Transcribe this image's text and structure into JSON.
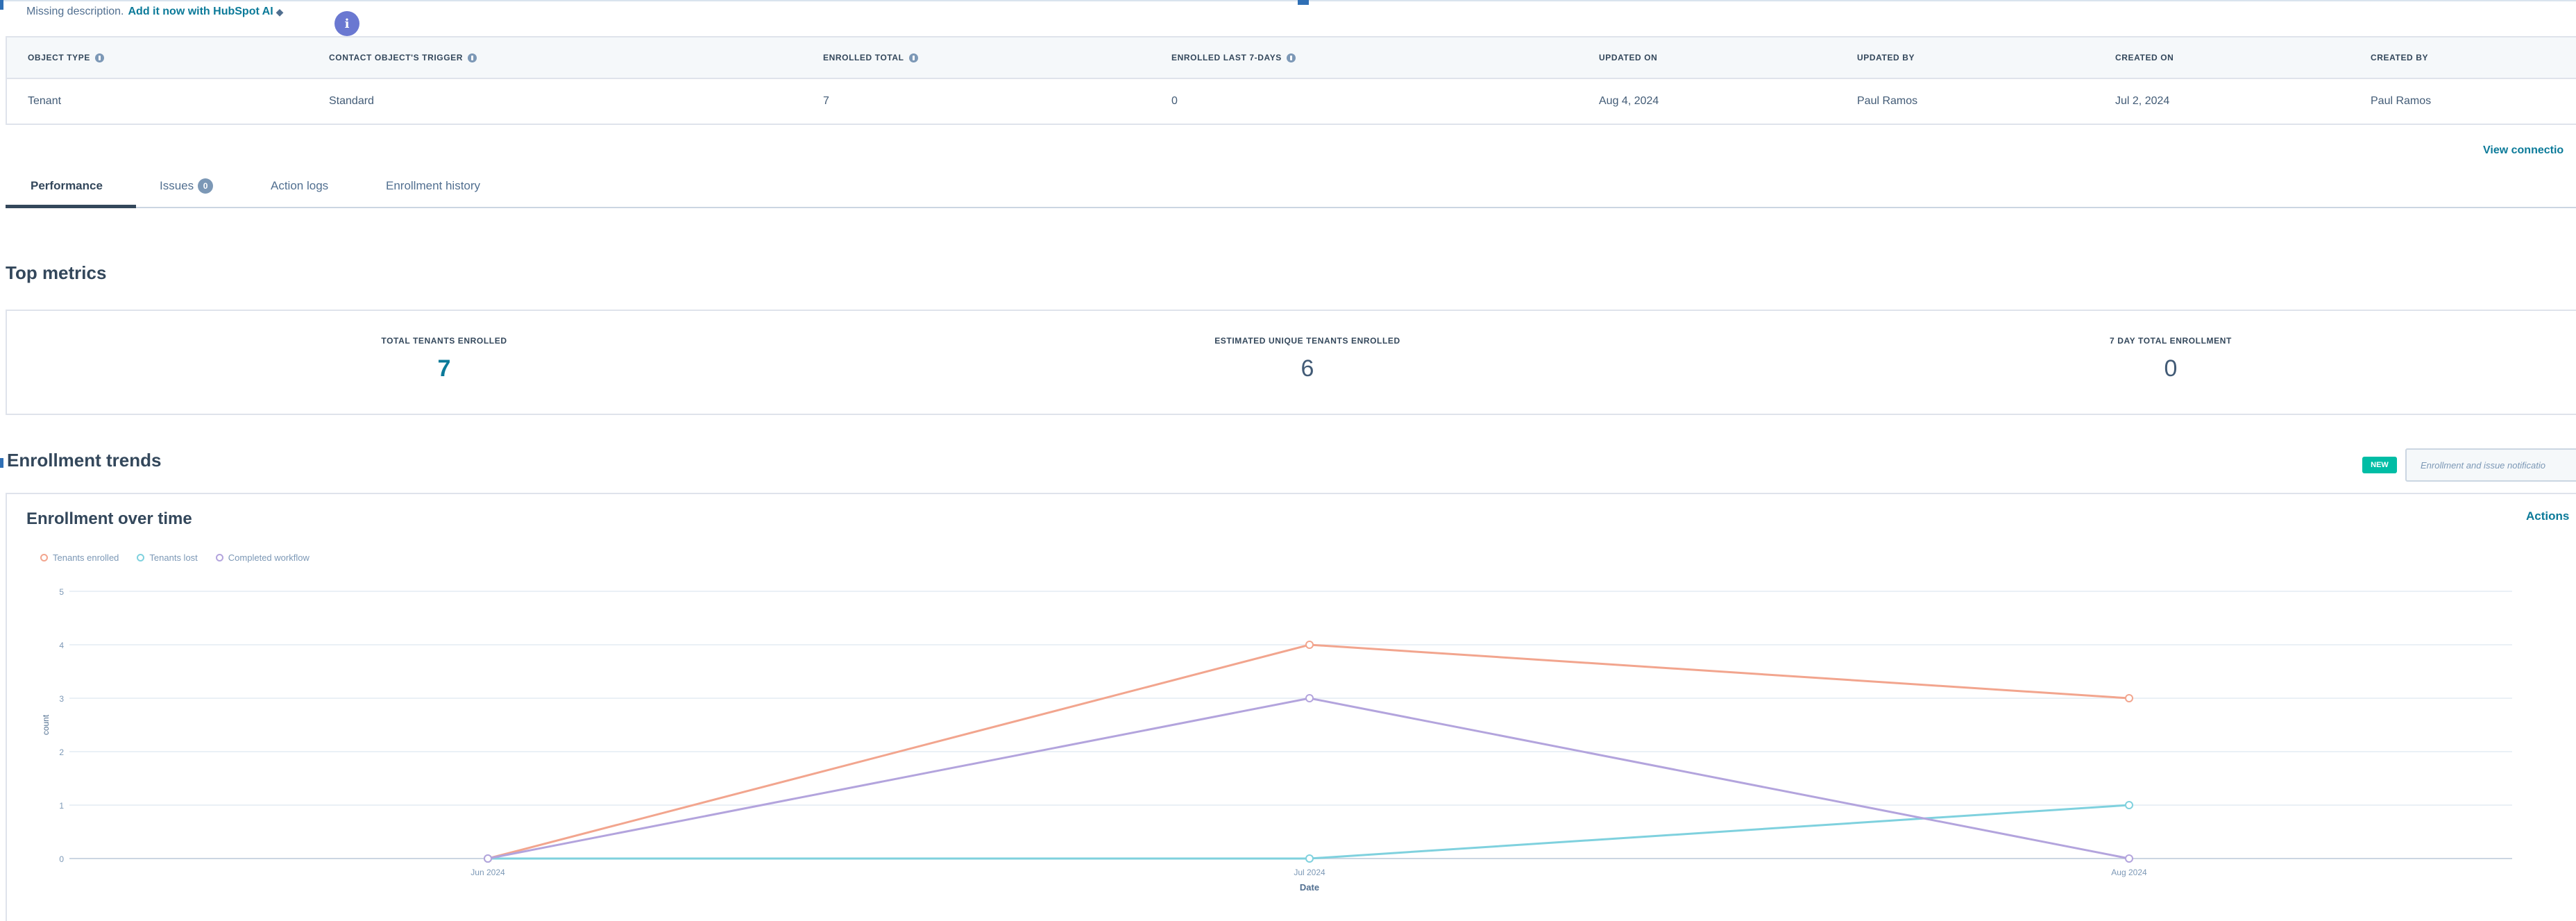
{
  "description": {
    "missing_text": "Missing description.",
    "ai_link": "Add it now with HubSpot AI",
    "info_badge": "i"
  },
  "properties": {
    "headers": [
      "OBJECT TYPE",
      "CONTACT OBJECT'S TRIGGER",
      "ENROLLED TOTAL",
      "ENROLLED LAST 7-DAYS",
      "UPDATED ON",
      "UPDATED BY",
      "CREATED ON",
      "CREATED BY"
    ],
    "values": [
      "Tenant",
      "Standard",
      "7",
      "0",
      "Aug 4, 2024",
      "Paul Ramos",
      "Jul 2, 2024",
      "Paul Ramos"
    ]
  },
  "view_connections_label": "View connectio",
  "tabs": [
    {
      "label": "Performance",
      "active": true
    },
    {
      "label": "Issues",
      "count": "0"
    },
    {
      "label": "Action logs"
    },
    {
      "label": "Enrollment history"
    }
  ],
  "top_metrics": {
    "title": "Top metrics",
    "items": [
      {
        "label": "TOTAL TENANTS ENROLLED",
        "value": "7"
      },
      {
        "label": "ESTIMATED UNIQUE TENANTS ENROLLED",
        "value": "6"
      },
      {
        "label": "7 DAY TOTAL ENROLLMENT",
        "value": "0"
      }
    ]
  },
  "enrollment_trends": {
    "title": "Enrollment trends",
    "new_badge": "NEW",
    "notification_placeholder": "Enrollment and issue notificatio"
  },
  "enrollment_chart": {
    "title": "Enrollment over time",
    "actions_label": "Actions"
  },
  "colors": {
    "tenants_enrolled": "#f2a58e",
    "tenants_lost": "#7fd1de",
    "completed_workflow": "#b3a4dd",
    "link": "#0b7a99",
    "text": "#33475b"
  },
  "chart_data": {
    "type": "line",
    "categories": [
      "Jun 2024",
      "Jul 2024",
      "Aug 2024"
    ],
    "xlabel": "Date",
    "ylabel": "count",
    "ylim": [
      0,
      5
    ],
    "yticks": [
      "0",
      "1",
      "2",
      "3",
      "4",
      "5"
    ],
    "grid": true,
    "legend": "top-left",
    "series": [
      {
        "name": "Tenants enrolled",
        "values": [
          0,
          4,
          3
        ]
      },
      {
        "name": "Tenants lost",
        "values": [
          0,
          0,
          1
        ]
      },
      {
        "name": "Completed workflow",
        "values": [
          0,
          3,
          0
        ]
      }
    ]
  }
}
